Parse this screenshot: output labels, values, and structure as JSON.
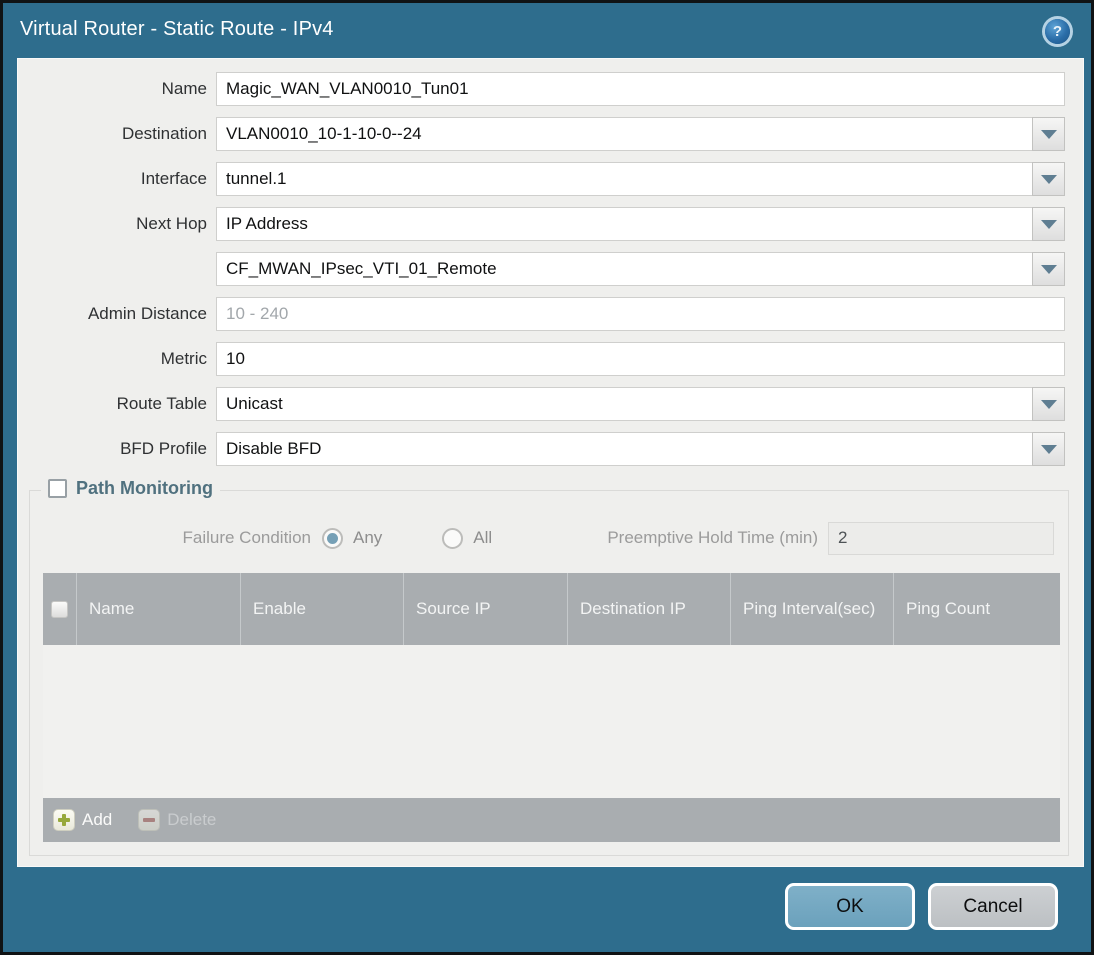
{
  "window": {
    "title": "Virtual Router - Static Route - IPv4",
    "help_icon_glyph": "?"
  },
  "form": {
    "fields": [
      {
        "label": "Name",
        "value": "Magic_WAN_VLAN0010_Tun01",
        "type": "text"
      },
      {
        "label": "Destination",
        "value": "VLAN0010_10-1-10-0--24",
        "type": "dropdown"
      },
      {
        "label": "Interface",
        "value": "tunnel.1",
        "type": "dropdown"
      },
      {
        "label": "Next Hop",
        "value": "IP Address",
        "type": "dropdown"
      },
      {
        "label": "",
        "value": "CF_MWAN_IPsec_VTI_01_Remote",
        "type": "dropdown"
      },
      {
        "label": "Admin Distance",
        "value": "",
        "placeholder": "10 - 240",
        "type": "text"
      },
      {
        "label": "Metric",
        "value": "10",
        "type": "text"
      },
      {
        "label": "Route Table",
        "value": "Unicast",
        "type": "dropdown"
      },
      {
        "label": "BFD Profile",
        "value": "Disable BFD",
        "type": "dropdown"
      }
    ]
  },
  "path_monitoring": {
    "title": "Path Monitoring",
    "checkbox_checked": false,
    "failure_condition": {
      "label": "Failure Condition",
      "options": [
        "Any",
        "All"
      ],
      "selected": "Any"
    },
    "preemptive": {
      "label": "Preemptive Hold Time (min)",
      "value": "2",
      "disabled": true
    },
    "table": {
      "columns": [
        "Name",
        "Enable",
        "Source IP",
        "Destination IP",
        "Ping Interval(sec)",
        "Ping Count"
      ],
      "rows": []
    },
    "toolbar": {
      "add_label": "Add",
      "delete_label": "Delete",
      "delete_disabled": true
    }
  },
  "dialog_buttons": {
    "ok": "OK",
    "cancel": "Cancel"
  },
  "colors": {
    "frame_teal": "#2e6d8d",
    "content_bg": "#efefed",
    "table_header_bg": "#a9adb0",
    "ok_button_bg": "#6ba1bc",
    "cancel_button_bg": "#bcc0c3",
    "pm_title": "#50717f",
    "radio_selected": "#76a0b6",
    "add_plus_green": "#97a93c",
    "delete_minus_red": "#a86058"
  }
}
